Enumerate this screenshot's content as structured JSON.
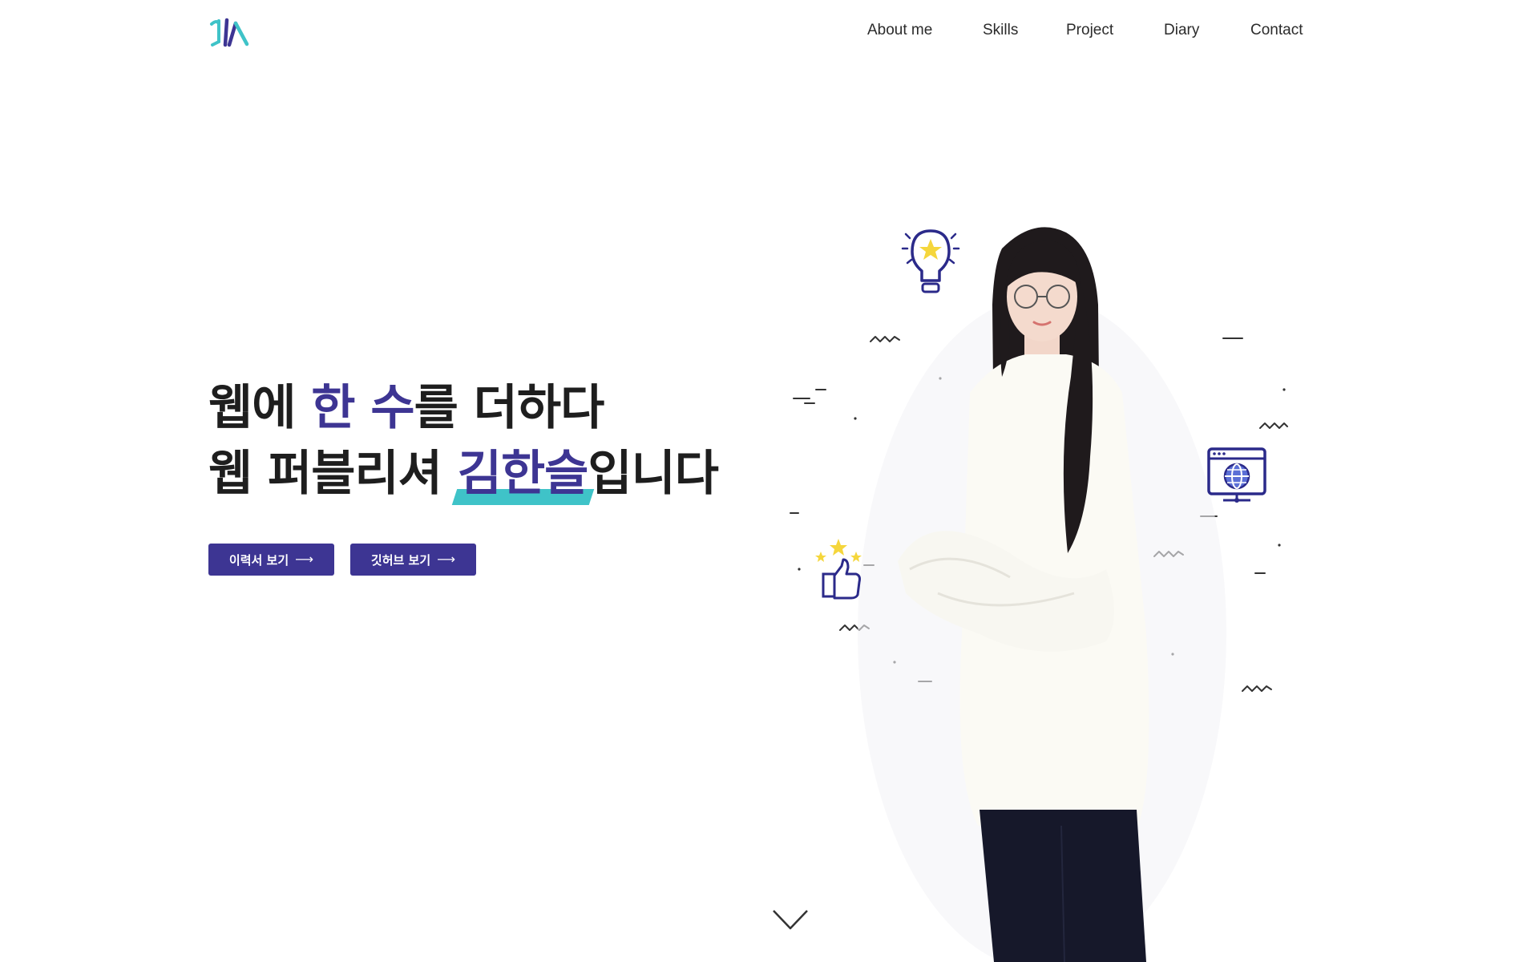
{
  "header": {
    "logo_icon": "kh-monogram-logo",
    "nav": [
      {
        "label": "About me"
      },
      {
        "label": "Skills"
      },
      {
        "label": "Project"
      },
      {
        "label": "Diary"
      },
      {
        "label": "Contact"
      }
    ]
  },
  "hero": {
    "line1": {
      "part1": "웹에 ",
      "accent1": "한 수",
      "part2": "를 더하다"
    },
    "line2": {
      "part1": "웹 퍼블리셔 ",
      "name": "김한슬",
      "part2": "입니다"
    },
    "buttons": [
      {
        "label": "이력서 보기",
        "icon": "arrow-right-icon"
      },
      {
        "label": "깃허브 보기",
        "icon": "arrow-right-icon"
      }
    ]
  },
  "colors": {
    "brand": "#3d3593",
    "highlight": "#3fc3c8",
    "star": "#f5d63c"
  },
  "icons": {
    "lightbulb": "lightbulb-icon",
    "thumbs_up": "thumbs-up-icon",
    "web_monitor": "web-monitor-icon",
    "scroll": "chevron-down-icon"
  }
}
